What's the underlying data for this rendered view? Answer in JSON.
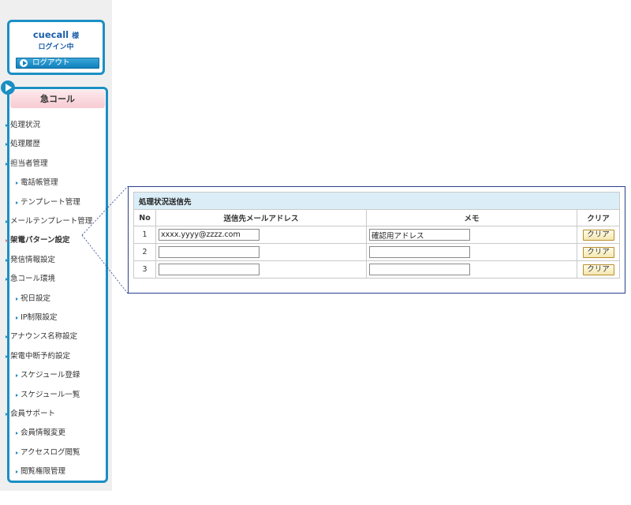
{
  "login": {
    "user_name": "cuecall",
    "honorific": "様",
    "status": "ログイン中",
    "logout_label": "ログアウト"
  },
  "menu": {
    "title": "急コール",
    "items": [
      {
        "label": "処理状況",
        "level": 1,
        "active": false
      },
      {
        "label": "処理履歴",
        "level": 1,
        "active": false
      },
      {
        "label": "担当者管理",
        "level": 1,
        "active": false
      },
      {
        "label": "電話帳管理",
        "level": 2,
        "active": false
      },
      {
        "label": "テンプレート管理",
        "level": 2,
        "active": false
      },
      {
        "label": "メールテンプレート管理",
        "level": 1,
        "active": false
      },
      {
        "label": "架電パターン設定",
        "level": 1,
        "active": true
      },
      {
        "label": "発信情報設定",
        "level": 1,
        "active": false
      },
      {
        "label": "急コール環境",
        "level": 1,
        "active": false
      },
      {
        "label": "祝日設定",
        "level": 2,
        "active": false
      },
      {
        "label": "IP制限設定",
        "level": 2,
        "active": false
      },
      {
        "label": "アナウンス名称設定",
        "level": 1,
        "active": false
      },
      {
        "label": "架電中断予約設定",
        "level": 1,
        "active": false
      },
      {
        "label": "スケジュール登録",
        "level": 2,
        "active": false
      },
      {
        "label": "スケジュール一覧",
        "level": 2,
        "active": false
      },
      {
        "label": "会員サポート",
        "level": 1,
        "active": false
      },
      {
        "label": "会員情報変更",
        "level": 2,
        "active": false
      },
      {
        "label": "アクセスログ閲覧",
        "level": 2,
        "active": false
      },
      {
        "label": "閲覧権限管理",
        "level": 2,
        "active": false
      }
    ]
  },
  "panel": {
    "caption": "処理状況送信先",
    "columns": [
      "No",
      "送信先メールアドレス",
      "メモ",
      "クリア"
    ],
    "rows": [
      {
        "no": "1",
        "email": "xxxx.yyyy@zzzz.com",
        "memo": "確認用アドレス",
        "clear_label": "クリア"
      },
      {
        "no": "2",
        "email": "",
        "memo": "",
        "clear_label": "クリア"
      },
      {
        "no": "3",
        "email": "",
        "memo": "",
        "clear_label": "クリア"
      }
    ]
  },
  "colors": {
    "accent": "#1b8fc4",
    "menu_header": "#f7cbd2",
    "panel_border": "#2a3f8f",
    "caption_bg": "#dbeef8"
  }
}
